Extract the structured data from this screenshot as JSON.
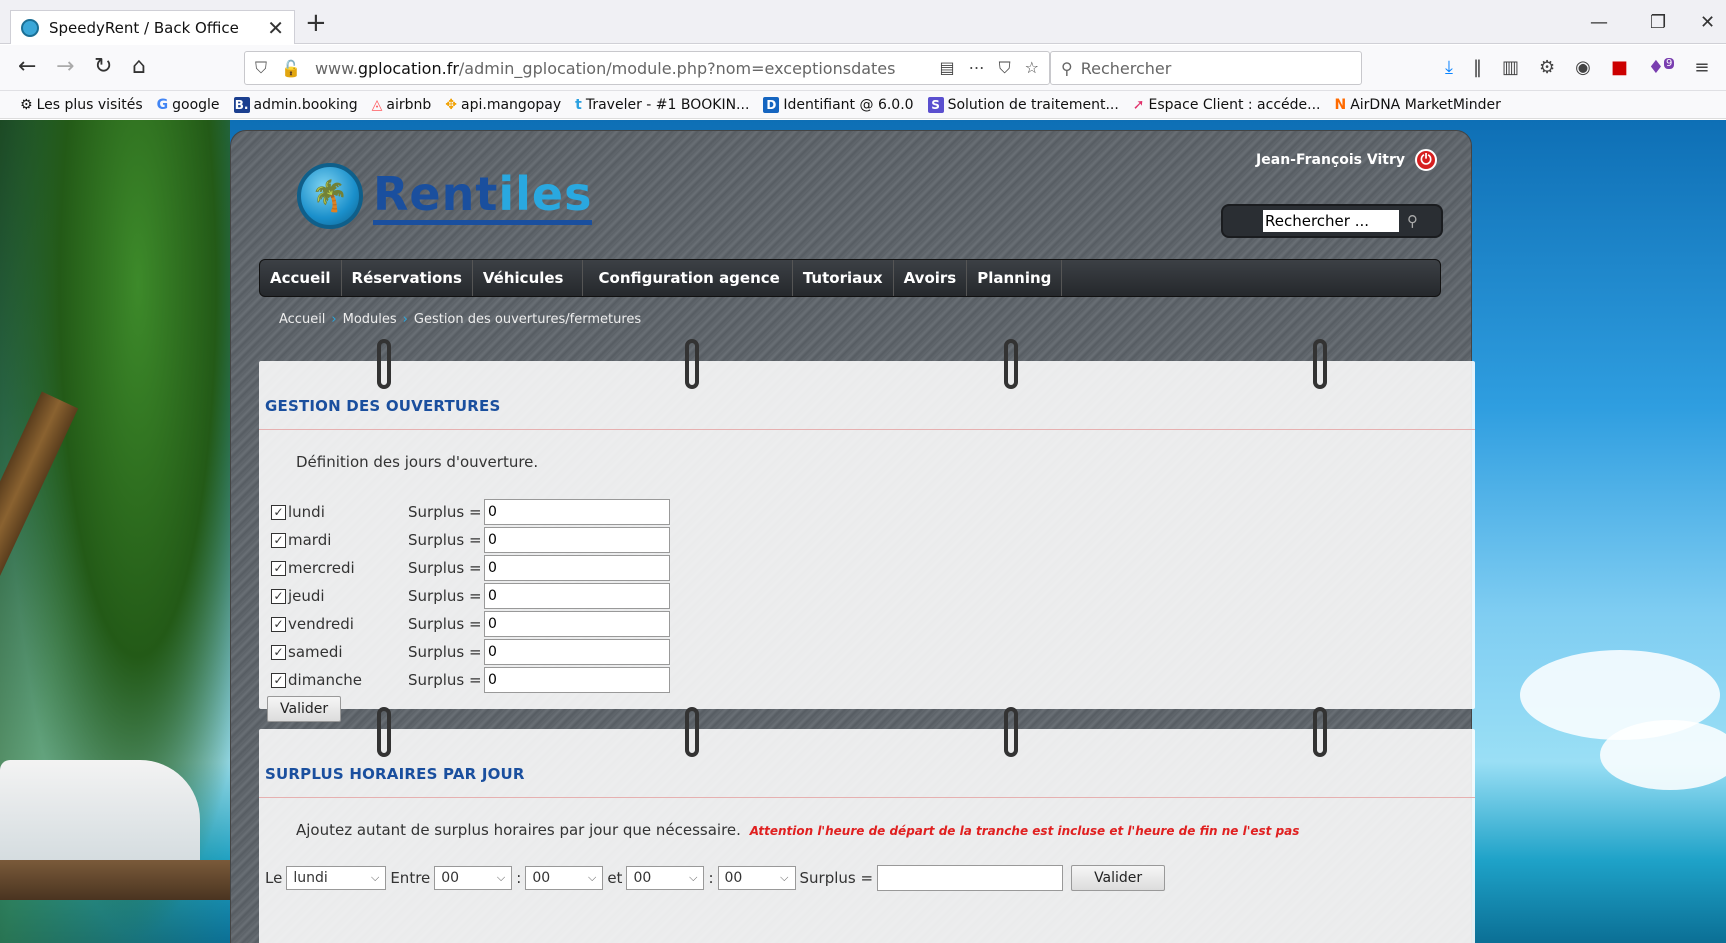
{
  "browser": {
    "tab_title": "SpeedyRent / Back Office",
    "url_host_prefix": "www.",
    "url_host_main": "gplocation.fr",
    "url_path": "/admin_gplocation/module.php?nom=exceptionsdates",
    "search_placeholder": "Rechercher",
    "extension_badge": "9"
  },
  "bookmarks": [
    {
      "label": "Les plus visités",
      "icon": "gear-icon"
    },
    {
      "label": "google",
      "icon": "google-icon"
    },
    {
      "label": "admin.booking",
      "icon": "booking-icon",
      "icon_text": "B."
    },
    {
      "label": "airbnb",
      "icon": "airbnb-icon"
    },
    {
      "label": "api.mangopay",
      "icon": "mangopay-icon"
    },
    {
      "label": "Traveler - #1 BOOKIN...",
      "icon": "traveler-icon"
    },
    {
      "label": "Identifiant @ 6.0.0",
      "icon": "d-icon",
      "icon_text": "D"
    },
    {
      "label": "Solution de traitement...",
      "icon": "s-icon",
      "icon_text": "S"
    },
    {
      "label": "Espace Client : accéde...",
      "icon": "arrow-icon"
    },
    {
      "label": "AirDNA MarketMinder",
      "icon": "airdna-icon",
      "icon_text": "N"
    }
  ],
  "site": {
    "brand_part1": "Rent",
    "brand_part2": "iles",
    "user_name": "Jean-François Vitry",
    "search_placeholder": "Rechercher ...",
    "nav": [
      "Accueil",
      "Réservations",
      "Véhicules",
      "Configuration agence",
      "Tutoriaux",
      "Avoirs",
      "Planning"
    ],
    "breadcrumbs": [
      "Accueil",
      "Modules",
      "Gestion des ouvertures/fermetures"
    ]
  },
  "openings": {
    "title": "GESTION DES OUVERTURES",
    "description": "Définition des jours d'ouverture.",
    "surplus_label": "Surplus =",
    "days": [
      {
        "name": "lundi",
        "checked": true,
        "surplus": "0"
      },
      {
        "name": "mardi",
        "checked": true,
        "surplus": "0"
      },
      {
        "name": "mercredi",
        "checked": true,
        "surplus": "0"
      },
      {
        "name": "jeudi",
        "checked": true,
        "surplus": "0"
      },
      {
        "name": "vendredi",
        "checked": true,
        "surplus": "0"
      },
      {
        "name": "samedi",
        "checked": true,
        "surplus": "0"
      },
      {
        "name": "dimanche",
        "checked": true,
        "surplus": "0"
      }
    ],
    "submit_label": "Valider"
  },
  "hourly": {
    "title": "SURPLUS HORAIRES PAR JOUR",
    "description": "Ajoutez autant de surplus horaires par jour que nécessaire.",
    "warning": "Attention l'heure de départ de la tranche est incluse et l'heure de fin ne l'est pas",
    "le_label": "Le",
    "day_value": "lundi",
    "entre_label": "Entre",
    "start_hour": "00",
    "start_min": "00",
    "et_label": "et",
    "end_hour": "00",
    "end_min": "00",
    "colon": ":",
    "surplus_label": "Surplus =",
    "surplus_value": "",
    "submit_label": "Valider"
  }
}
